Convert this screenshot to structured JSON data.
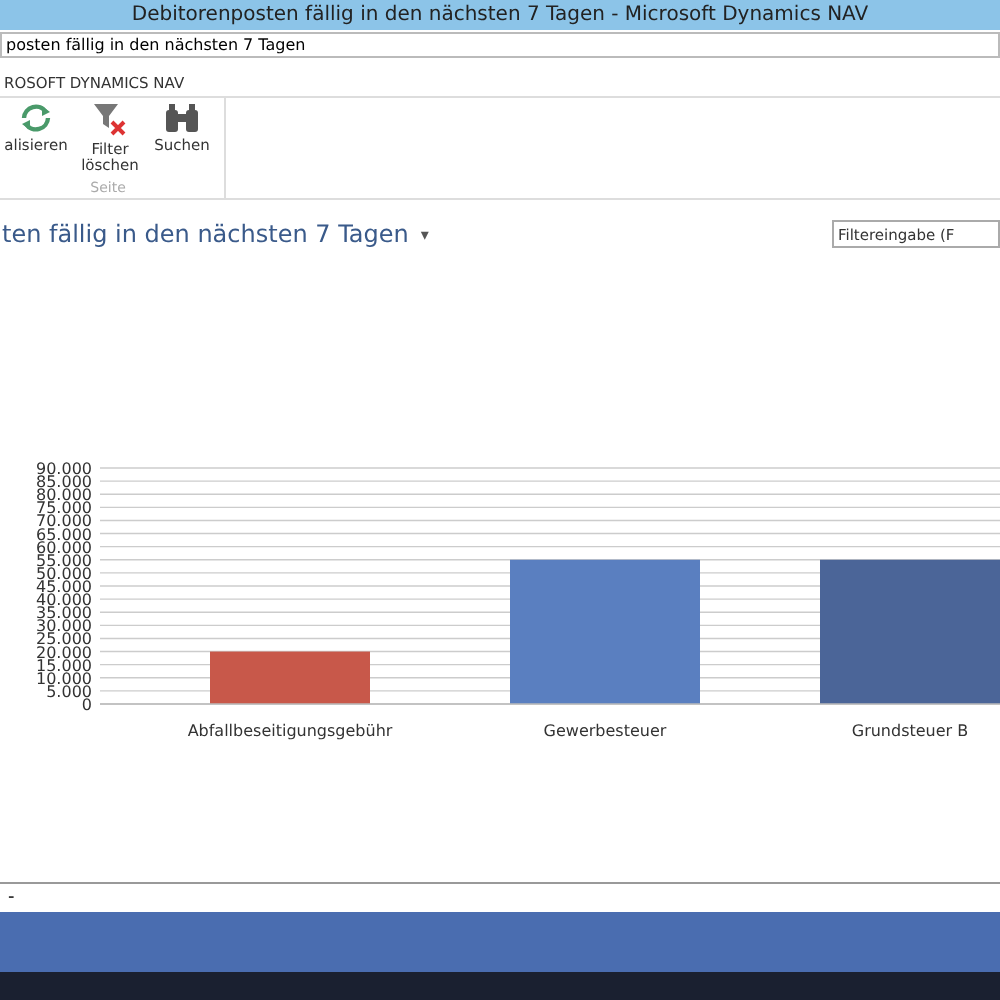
{
  "window": {
    "title": "Debitorenposten fällig in den nächsten 7 Tagen - Microsoft Dynamics NAV"
  },
  "address_bar": {
    "text": "posten fällig in den nächsten 7 Tagen"
  },
  "ribbon": {
    "tab": "ROSOFT DYNAMICS NAV",
    "group": "Seite",
    "buttons": [
      {
        "kind": "refresh",
        "label": "alisieren"
      },
      {
        "kind": "clear-filter",
        "label": "Filter löschen"
      },
      {
        "kind": "find",
        "label": "Suchen"
      }
    ]
  },
  "page": {
    "title": "ten fällig in den nächsten 7 Tagen",
    "title_caret": "▾",
    "filter": {
      "placeholder": "Filtereingabe (F"
    }
  },
  "chart": {
    "chart_data": {
      "type": "bar",
      "categories": [
        "Abfallbeseitigungsgebühr",
        "Gewerbesteuer",
        "Grundsteuer B"
      ],
      "series": [
        {
          "values": [
            20000,
            55000,
            55000
          ]
        }
      ],
      "ylim": [
        0,
        90000
      ],
      "grid": true,
      "yticks": [
        {
          "value": 0,
          "label": "0"
        },
        {
          "value": 5000,
          "label": "5.000"
        },
        {
          "value": 10000,
          "label": "10.000"
        },
        {
          "value": 15000,
          "label": "15.000"
        },
        {
          "value": 20000,
          "label": "20.000"
        },
        {
          "value": 25000,
          "label": "25.000"
        },
        {
          "value": 30000,
          "label": "30.000"
        },
        {
          "value": 35000,
          "label": "35.000"
        },
        {
          "value": 40000,
          "label": "40.000"
        },
        {
          "value": 45000,
          "label": "45.000"
        },
        {
          "value": 50000,
          "label": "50.000"
        },
        {
          "value": 55000,
          "label": "55.000"
        },
        {
          "value": 60000,
          "label": "60.000"
        },
        {
          "value": 65000,
          "label": "65.000"
        },
        {
          "value": 70000,
          "label": "70.000"
        },
        {
          "value": 75000,
          "label": "75.000"
        },
        {
          "value": 80000,
          "label": "80.000"
        },
        {
          "value": 85000,
          "label": "85.000"
        },
        {
          "value": 90000,
          "label": "90.000"
        }
      ]
    }
  },
  "footer": {
    "dropdown": "-"
  }
}
